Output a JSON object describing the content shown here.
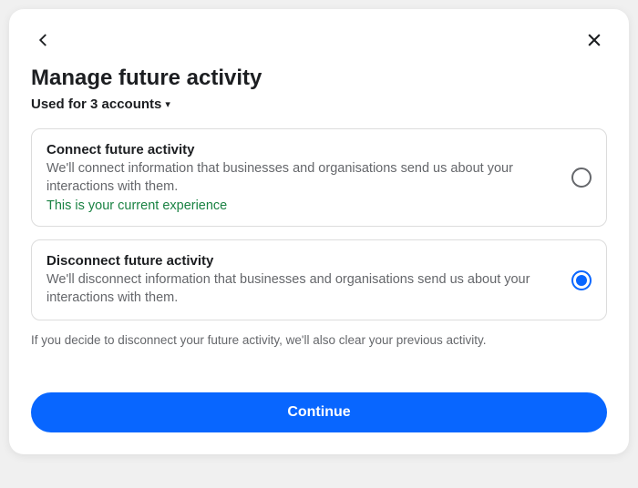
{
  "title": "Manage future activity",
  "subtitle": "Used for 3 accounts",
  "options": [
    {
      "title": "Connect future activity",
      "desc": "We'll connect information that businesses and organisations send us about your interactions with them.",
      "note": "This is your current experience",
      "selected": false
    },
    {
      "title": "Disconnect future activity",
      "desc": "We'll disconnect information that businesses and organisations send us about your interactions with them.",
      "note": "",
      "selected": true
    }
  ],
  "info_text": "If you decide to disconnect your future activity, we'll also clear your previous activity.",
  "continue_label": "Continue"
}
